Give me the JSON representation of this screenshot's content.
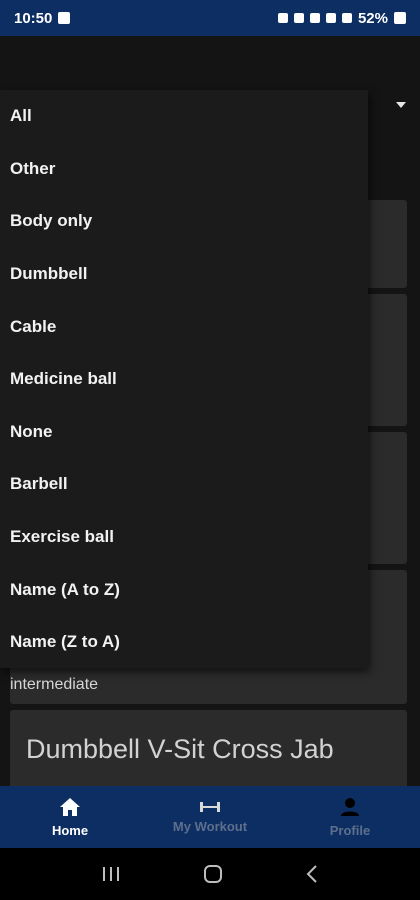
{
  "status_bar": {
    "time": "10:50",
    "battery": "52%"
  },
  "filter_menu": {
    "items": [
      "All",
      "Other",
      "Body only",
      "Dumbbell",
      "Cable",
      "Medicine ball",
      "None",
      "Barbell",
      "Exercise ball",
      "Name (A to Z)",
      "Name (Z to A)"
    ]
  },
  "cards": {
    "visible_level": "intermediate",
    "visible_title": "Dumbbell V-Sit Cross Jab"
  },
  "bottom_nav": {
    "home": "Home",
    "workout": "My Workout",
    "profile": "Profile",
    "active": "Home"
  },
  "colors": {
    "nav_bg": "#0d2e63",
    "app_bg": "#141414",
    "menu_bg": "#1b1b1b",
    "card_bg": "#2b2b2b"
  }
}
